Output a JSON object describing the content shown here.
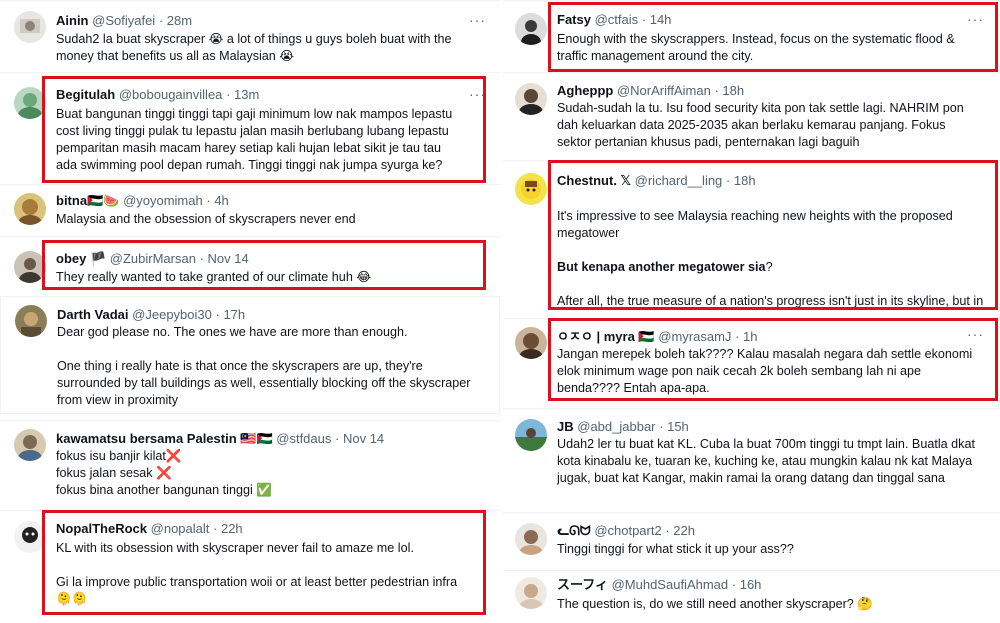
{
  "more_label": "···",
  "left": [
    {
      "name": "Ainin",
      "handle": "@Sofiyafei",
      "time": "28m",
      "text": "Sudah2 la buat skyscraper 😭 a lot of things u guys boleh buat with the money that benefits us all as Malaysian 😭"
    },
    {
      "name": "Begitulah",
      "handle": "@bobougainvillea",
      "time": "13m",
      "text": "Buat bangunan tinggi tinggi tapi gaji minimum low nak mampos lepastu cost living tinggi pulak tu lepastu jalan masih berlubang lubang lepastu pemparitan masih macam harey setiap kali hujan lebat sikit je tau tau ada swimming pool depan rumah. Tinggi tinggi nak jumpa syurga ke?"
    },
    {
      "name": "bitna🇵🇸🍉",
      "handle": "@yoyomimah",
      "time": "4h",
      "text": "Malaysia and the obsession of skyscrapers never end"
    },
    {
      "name": "obey 🏴",
      "handle": "@ZubirMarsan",
      "time": "Nov 14",
      "text": "They really wanted to take granted of our climate huh 😂"
    },
    {
      "name": "Darth Vadai",
      "handle": "@Jeepyboi30",
      "time": "17h",
      "text": "Dear god please no. The ones we have are more than enough.\n\nOne thing i really hate is that once the skyscrapers are up, they're surrounded by tall buildings as well, essentially blocking off the skyscraper from view in proximity"
    },
    {
      "name": "kawamatsu bersama Palestin 🇲🇾🇵🇸",
      "handle": "@stfdaus",
      "time": "Nov 14",
      "text": "fokus isu banjir kilat❌\nfokus jalan sesak ❌\nfokus bina another bangunan tinggi ✅"
    },
    {
      "name": "NopalTheRock",
      "handle": "@nopalalt",
      "time": "22h",
      "text": "KL with its obsession with skyscraper never fail to amaze me lol.\n\nGi la improve public transportation woii or at least better pedestrian infra 🫠🫠"
    }
  ],
  "right": [
    {
      "name": "Fatsy",
      "handle": "@ctfais",
      "time": "14h",
      "text": "Enough with the skyscrappers. Instead, focus on the systematic flood & traffic management around the city."
    },
    {
      "name": "Agheppp",
      "handle": "@NorAriffAiman",
      "time": "18h",
      "text": "Sudah-sudah la tu. Isu food security kita pon tak settle lagi. NAHRIM pon dah keluarkan data 2025-2035 akan berlaku kemarau panjang. Fokus sektor pertanian khusus padi, penternakan lagi baguih"
    },
    {
      "name": "Chestnut. 𝕏",
      "handle": "@richard__ling",
      "time": "18h",
      "text": "It's impressive to see Malaysia reaching new heights with the proposed megatower",
      "bold": "But kenapa another megatower sia",
      "bold_tail": "?",
      "text2": "After all, the true measure of a nation's progress isn't just in its skyline, but in the quality of life it offers to its people."
    },
    {
      "name": "ㅇㅈㅇ | myra 🇵🇸",
      "handle": "@myrasamJ",
      "time": "1h",
      "text": "Jangan merepek boleh tak???? Kalau masalah negara dah settle ekonomi elok minimum wage pon naik cecah 2k boleh sembang lah ni ape benda???? Entah apa-apa."
    },
    {
      "name": "JB",
      "handle": "@abd_jabbar",
      "time": "15h",
      "text": "Udah2 ler tu buat kat KL. Cuba la buat 700m tinggi tu tmpt lain. Buatla dkat kota kinabalu ke, tuaran ke, kuching ke, atau mungkin kalau nk kat Malaya jugak, buat kat Kangar, makin ramai la orang datang dan tinggal sana"
    },
    {
      "name": "ᓚᘏᗢ",
      "handle": "@chotpart2",
      "time": "22h",
      "text": "Tinggi tinggi for what stick it up your ass??"
    },
    {
      "name": "スーフィ",
      "handle": "@MuhdSaufiAhmad",
      "time": "16h",
      "text": "The question is, do we still need another skyscraper? 🤔"
    }
  ],
  "colors": {
    "highlight": "#d9111e",
    "meta": "#536471",
    "text": "#0f1419",
    "divider": "#eff3f4"
  }
}
